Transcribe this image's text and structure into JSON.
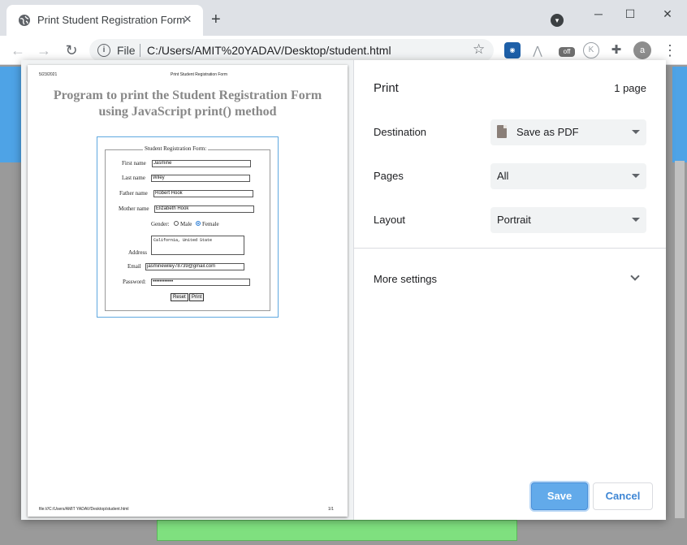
{
  "browser": {
    "tab_title": "Print Student Registration Form",
    "url_scheme": "File",
    "url": "C:/Users/AMIT%20YADAV/Desktop/student.html",
    "extensions": [
      "ext-globe-icon",
      "ext-arrow-icon",
      "ext-off-icon",
      "ext-k-icon",
      "puzzle-icon",
      "avatar"
    ],
    "ext_off_label": "off",
    "avatar_letter": "a"
  },
  "preview": {
    "header_date": "5/23/2021",
    "header_title": "Print Student Registration Form",
    "footer_path": "file:///C:/Users/AMIT YADAV/Desktop/student.html",
    "footer_page": "1/1",
    "heading_line1": "Program to print the Student Registration Form",
    "heading_line2": "using JavaScript print() method",
    "form": {
      "legend": "Student Registration Form:",
      "first_name_label": "First name",
      "first_name_value": "Jasmine",
      "last_name_label": "Last name",
      "last_name_value": "Wiley",
      "father_name_label": "Father name",
      "father_name_value": "Robert Hook",
      "mother_name_label": "Mother name",
      "mother_name_value": "Elizabeth Hook",
      "gender_label": "Gender:",
      "gender_male": "Male",
      "gender_female": "Female",
      "gender_selected": "Female",
      "address_label": "Address",
      "address_value": "California, United State",
      "email_label": "Email",
      "email_value": "jasminewiley78739@gmail.com",
      "password_label": "Password:",
      "password_value": "••••••••••••",
      "reset_label": "Reset",
      "print_label": "Print"
    }
  },
  "settings": {
    "title": "Print",
    "page_count": "1 page",
    "destination_label": "Destination",
    "destination_value": "Save as PDF",
    "pages_label": "Pages",
    "pages_value": "All",
    "layout_label": "Layout",
    "layout_value": "Portrait",
    "more_settings_label": "More settings",
    "save_label": "Save",
    "cancel_label": "Cancel"
  },
  "colors": {
    "accent": "#62aaea",
    "cancel_text": "#3e86d4"
  }
}
